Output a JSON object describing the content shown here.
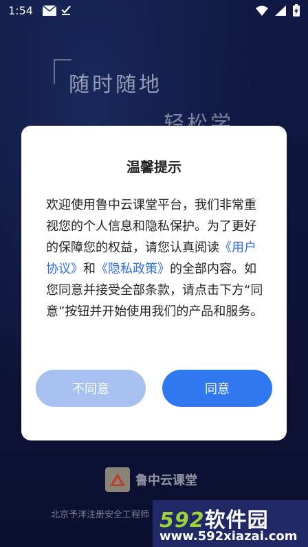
{
  "status_bar": {
    "time": "1:54",
    "icons": [
      "mail-icon",
      "download-done-icon",
      "wifi-icon",
      "signal-icon",
      "battery-charging-icon"
    ]
  },
  "background": {
    "slogan_line1": "随时随地",
    "slogan_line2": "轻松学",
    "brand_name": "鲁中云课堂",
    "bottom_text": "北京予洋注册安全工程师"
  },
  "dialog": {
    "title": "温馨提示",
    "body_part1": "欢迎使用鲁中云课堂平台，我们非常重视您的个人信息和隐私保护。为了更好的保障您的权益，请您认真阅读",
    "link_user_agreement": "《用户协议》",
    "body_and": "和",
    "link_privacy_policy": "《隐私政策》",
    "body_part2": "的全部内容。如您同意并接受全部条款，请点击下方“同意”按钮并开始使用我们的产品和服务。",
    "disagree_label": "不同意",
    "agree_label": "同意"
  },
  "watermark": {
    "number": "592",
    "brand_text": "软件园",
    "url": "www.592xiazai.com"
  },
  "colors": {
    "accent": "#2f78f0",
    "disabled_button": "#a6c0f0",
    "link": "#2f6fe6"
  }
}
